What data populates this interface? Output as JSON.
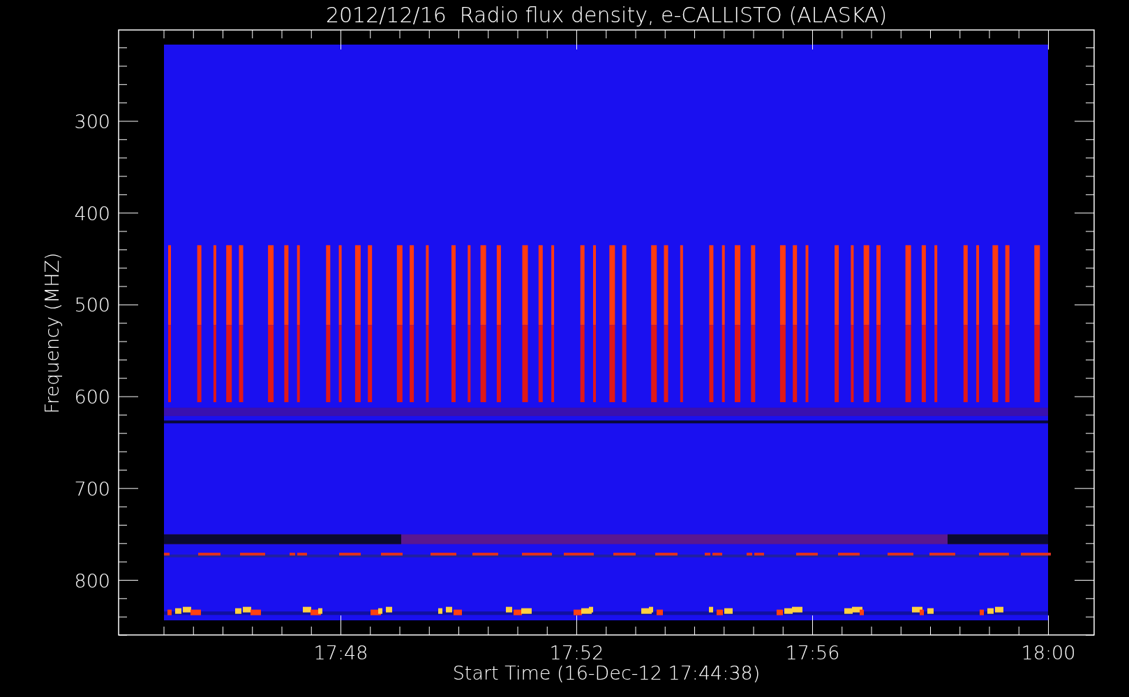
{
  "title": "2012/12/16  Radio flux density, e-CALLISTO (ALASKA)",
  "y_axis": {
    "label": "Frequency (MHZ)",
    "ticks": [
      "300",
      "400",
      "500",
      "600",
      "700",
      "800"
    ]
  },
  "x_axis": {
    "label": "Start Time (16-Dec-12 17:44:38)",
    "ticks": [
      "17:48",
      "17:52",
      "17:56",
      "18:00"
    ]
  }
}
